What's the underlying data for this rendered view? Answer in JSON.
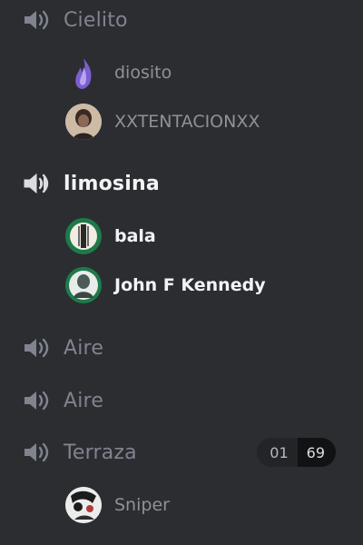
{
  "channels": [
    {
      "name": "Cielito",
      "active": false
    },
    {
      "name": "limosina",
      "active": true
    },
    {
      "name": "Aire",
      "active": false
    },
    {
      "name": "Aire",
      "active": false
    },
    {
      "name": "Terraza",
      "active": false
    }
  ],
  "users": {
    "cielito": [
      {
        "name": "diosito",
        "avatar": "purple-flame-avatar"
      },
      {
        "name": "XXTENTACIONXX",
        "avatar": "portrait-avatar"
      }
    ],
    "limosina": [
      {
        "name": "bala",
        "avatar": "green-ring-avatar"
      },
      {
        "name": "John F Kennedy",
        "avatar": "green-portrait-avatar"
      }
    ],
    "terraza": [
      {
        "name": "Sniper",
        "avatar": "sniper-avatar"
      }
    ]
  },
  "terraza_limit": {
    "current": "01",
    "max": "69"
  },
  "colors": {
    "background": "#2b2d31",
    "muted_text": "#80848e",
    "active_text": "#f2f3f5"
  }
}
